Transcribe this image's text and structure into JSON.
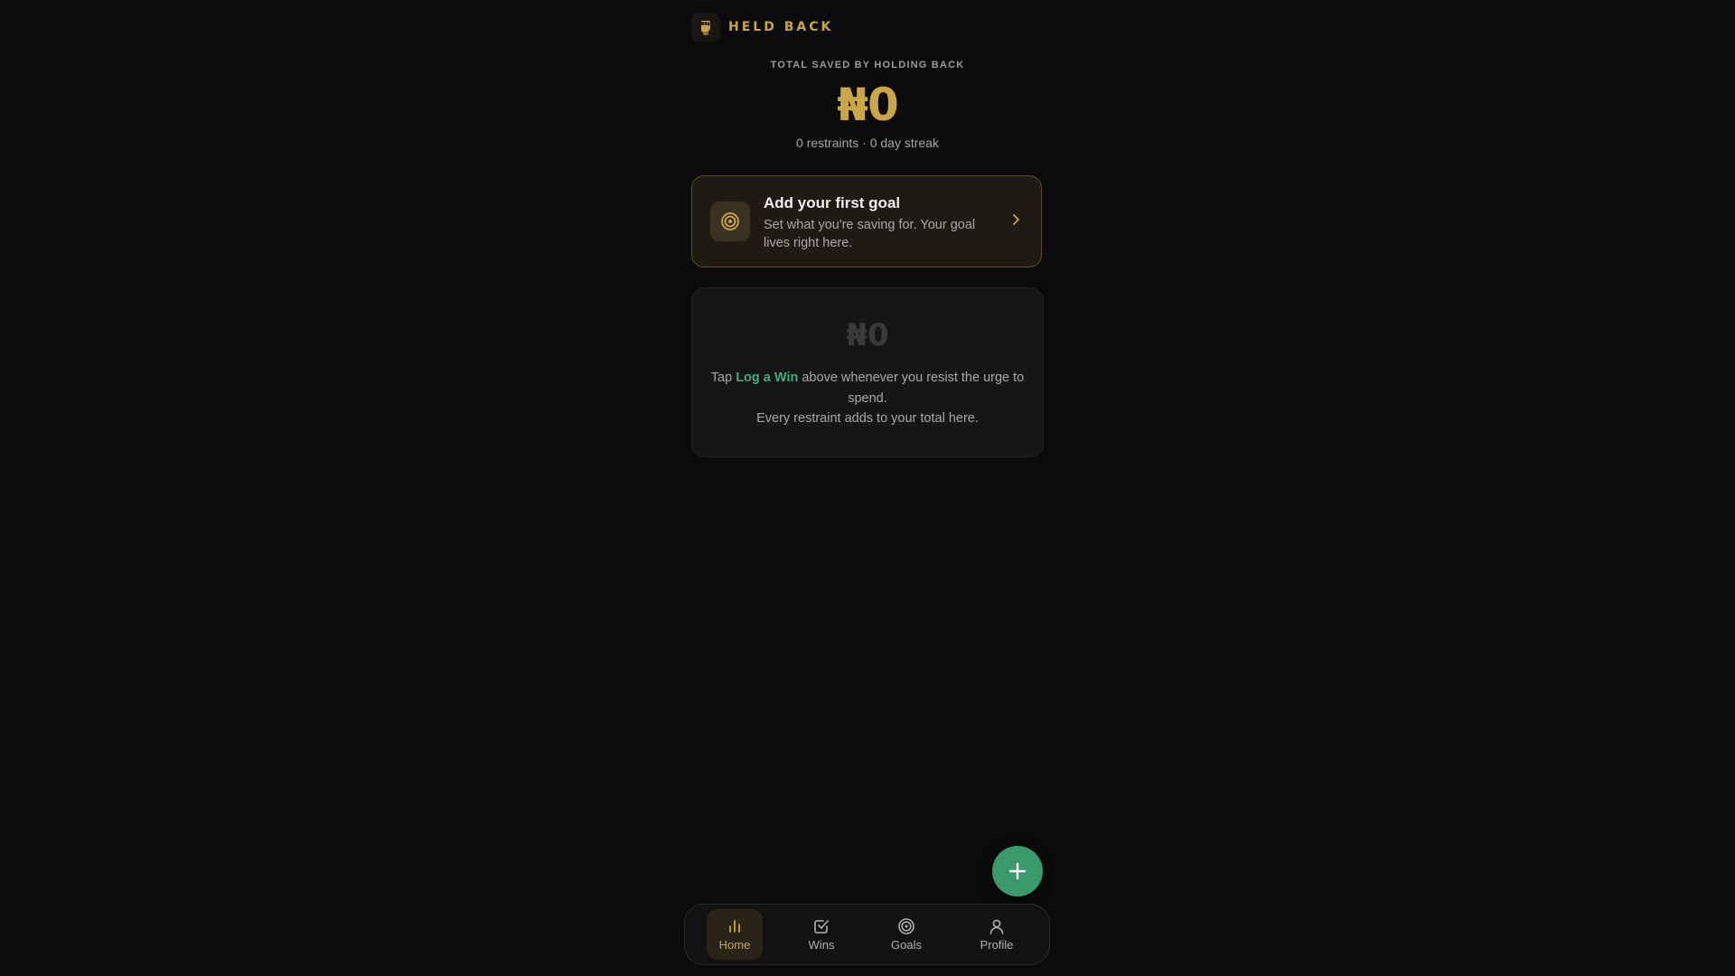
{
  "header": {
    "brand_name": "HELD BACK"
  },
  "summary": {
    "label": "TOTAL SAVED BY HOLDING BACK",
    "amount": "₦0",
    "meta": "0 restraints · 0 day streak"
  },
  "goal_card": {
    "title": "Add your first goal",
    "subtitle": "Set what you're saving for. Your goal lives right here."
  },
  "empty_state": {
    "amount": "₦0",
    "text_before": "Tap ",
    "link": "Log a Win",
    "text_after": " above whenever you resist the urge to spend.",
    "line2": "Every restraint adds to your total here."
  },
  "nav": {
    "items": [
      {
        "label": "Home",
        "icon": "bar-chart-icon",
        "active": true
      },
      {
        "label": "Wins",
        "icon": "checkbox-icon",
        "active": false
      },
      {
        "label": "Goals",
        "icon": "target-icon",
        "active": false
      },
      {
        "label": "Profile",
        "icon": "user-icon",
        "active": false
      }
    ]
  },
  "colors": {
    "background": "#0b0b0b",
    "accent_gold": "#c9a646",
    "accent_green": "#3a9a6b"
  }
}
